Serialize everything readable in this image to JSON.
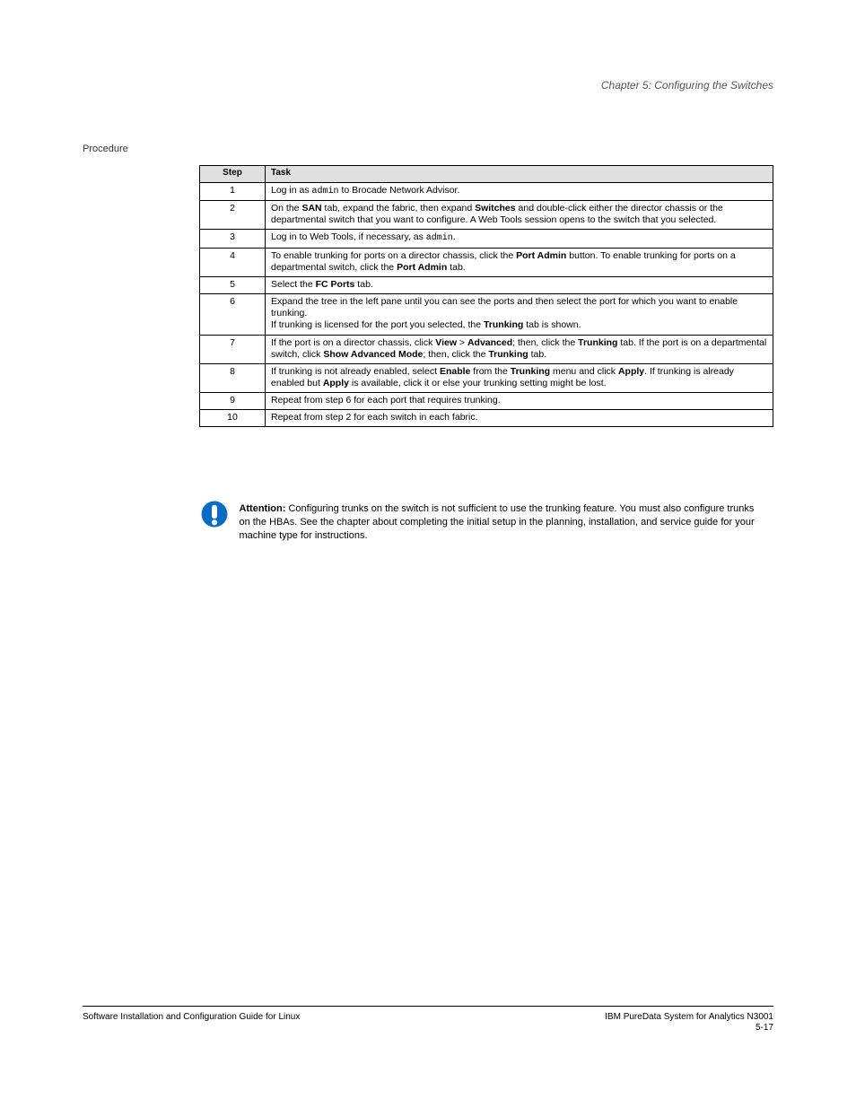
{
  "header": {
    "chapter": "Chapter 5: Configuring the Switches"
  },
  "section_label": "Procedure",
  "table": {
    "header_step": "Step",
    "header_task": "Task",
    "rows": [
      {
        "step": "1",
        "task_html": "Log in as <span class='monos'>admin</span> to Brocade Network Advisor."
      },
      {
        "step": "2",
        "task_html": "On the <b>SAN</b> tab, expand the fabric, then expand <b>Switches</b> and double-click either the director chassis or the departmental switch that you want to configure. A Web Tools session opens to the switch that you selected."
      },
      {
        "step": "3",
        "task_html": "Log in to Web Tools, if necessary, as <span class='monos'>admin</span>."
      },
      {
        "step": "4",
        "task_html": "To enable trunking for ports on a director chassis, click the <b>Port Admin</b> button. To enable trunking for ports on a departmental switch, click the <b>Port Admin</b> tab."
      },
      {
        "step": "5",
        "task_html": "Select the <b>FC Ports</b> tab."
      },
      {
        "step": "6",
        "task_html": "Expand the tree in the left pane until you can see the ports and then select the port for which you want to enable trunking.<br>If trunking is licensed for the port you selected, the <b>Trunking</b> tab is shown."
      },
      {
        "step": "7",
        "task_html": "If the port is on a director chassis, click <b>View</b> > <b>Advanced</b>; then, click the <b>Trunking</b> tab. If the port is on a departmental switch, click <b>Show Advanced Mode</b>; then, click the <b>Trunking</b> tab."
      },
      {
        "step": "8",
        "task_html": "If trunking is not already enabled, select <b>Enable</b> from the <b>Trunking</b> menu and click <b>Apply</b>. If trunking is already enabled but <b>Apply</b> is available, click it or else your trunking setting might be lost."
      },
      {
        "step": "9",
        "task_html": "Repeat from step 6 for each port that requires trunking."
      },
      {
        "step": "10",
        "task_html": "Repeat from step 2 for each switch in each fabric."
      }
    ]
  },
  "callout": {
    "label": "Attention:",
    "text": "Configuring trunks on the switch is not sufficient to use the trunking feature. You must also configure trunks on the HBAs. See the chapter about completing the initial setup in the planning, installation, and service guide for your machine type for instructions."
  },
  "footer": {
    "left": "Software Installation and Configuration Guide for Linux",
    "right_top": "IBM PureData System for Analytics N3001",
    "right_pg": "5-17"
  }
}
